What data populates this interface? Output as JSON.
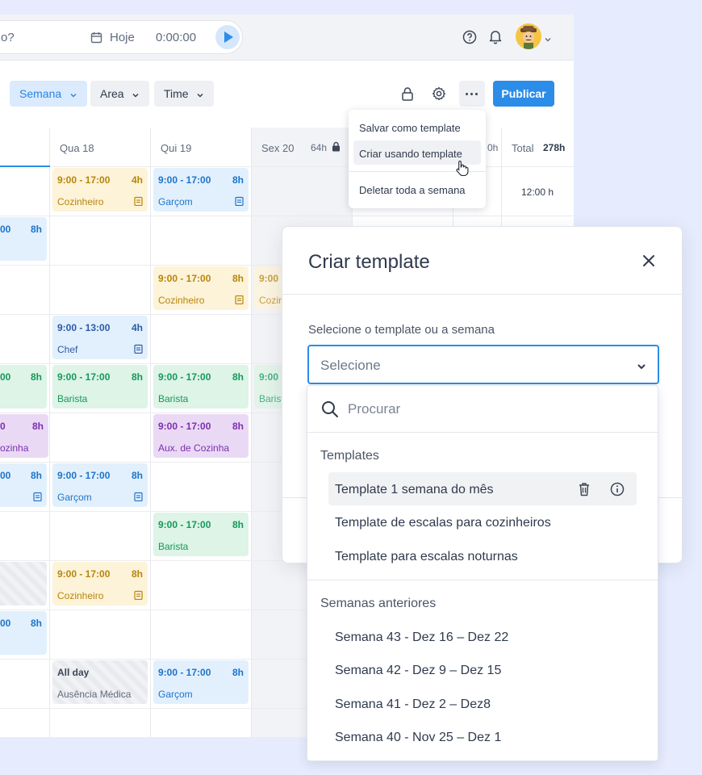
{
  "topbar": {
    "search_fragment": "o?",
    "today_label": "Hoje",
    "timer": "0:00:00"
  },
  "toolbar": {
    "week_label": "Semana",
    "area_label": "Area",
    "time_label": "Time",
    "publish_label": "Publicar"
  },
  "grid": {
    "columns": [
      {
        "day": "Qua 18"
      },
      {
        "day": "Qui 19"
      },
      {
        "day": "Sex 20",
        "hours": "64h"
      },
      {
        "day": "Total",
        "hours": "278h"
      }
    ],
    "partial_hours": "0h",
    "total_cell": "12:00 h",
    "shifts": {
      "r1": {
        "qua_time": "9:00 - 17:00",
        "qua_hours": "4h",
        "qua_role": "Cozinheiro",
        "qui_time": "9:00 - 17:00",
        "qui_hours": "8h",
        "qui_role": "Garçom"
      },
      "r2": {
        "prev_time": "00",
        "prev_hours": "8h"
      },
      "r3": {
        "qui_time": "9:00 - 17:00",
        "qui_hours": "8h",
        "qui_role": "Cozinheiro",
        "sex_time": "9:00",
        "sex_role": "Cozir"
      },
      "r4": {
        "qua_time": "9:00 - 13:00",
        "qua_hours": "4h",
        "qua_role": "Chef"
      },
      "r5": {
        "prev_time": "00",
        "prev_hours": "8h",
        "qua_time": "9:00 - 17:00",
        "qua_hours": "8h",
        "qua_role": "Barista",
        "qui_time": "9:00 - 17:00",
        "qui_hours": "8h",
        "qui_role": "Barista",
        "sex_time": "9:00",
        "sex_role": "Barist"
      },
      "r6": {
        "prev_time": "0",
        "prev_hours": "8h",
        "prev_role": "ozinha",
        "qui_time": "9:00 - 17:00",
        "qui_hours": "8h",
        "qui_role": "Aux. de Cozinha"
      },
      "r7": {
        "prev_time": "00",
        "prev_hours": "8h",
        "qua_time": "9:00 - 17:00",
        "qua_hours": "8h",
        "qua_role": "Garçom"
      },
      "r8": {
        "qui_time": "9:00 - 17:00",
        "qui_hours": "8h",
        "qui_role": "Barista"
      },
      "r9": {
        "qua_time": "9:00 - 17:00",
        "qua_hours": "8h",
        "qua_role": "Cozinheiro"
      },
      "r10": {
        "prev_time": "00",
        "prev_hours": "8h"
      },
      "r11": {
        "qua_time": "All day",
        "qua_role": "Ausência Médica",
        "qui_time": "9:00 - 17:00",
        "qui_hours": "8h",
        "qui_role": "Garçom"
      }
    }
  },
  "menu": {
    "items": [
      "Salvar como template",
      "Criar usando template",
      "Deletar toda a semana"
    ]
  },
  "modal": {
    "title": "Criar template",
    "select_label": "Selecione o template ou a semana",
    "select_placeholder": "Selecione"
  },
  "dropdown": {
    "search_placeholder": "Procurar",
    "templates_heading": "Templates",
    "templates": [
      "Template 1 semana do mês",
      "Template de escalas para cozinheiros",
      "Template para escalas noturnas"
    ],
    "weeks_heading": "Semanas anteriores",
    "weeks": [
      "Semana 43 - Dez 16 – Dez 22",
      "Semana 42 - Dez 9 – Dez 15",
      "Semana 41 - Dez 2 – Dez8",
      "Semana 40 - Nov 25 – Dez 1"
    ]
  },
  "colors": {
    "accent": "#2b8de8",
    "cozinheiro": "#fdf3d8",
    "garcom": "#e2f0fd",
    "barista": "#ddf4e7",
    "aux_cozinha": "#ead9f4"
  }
}
